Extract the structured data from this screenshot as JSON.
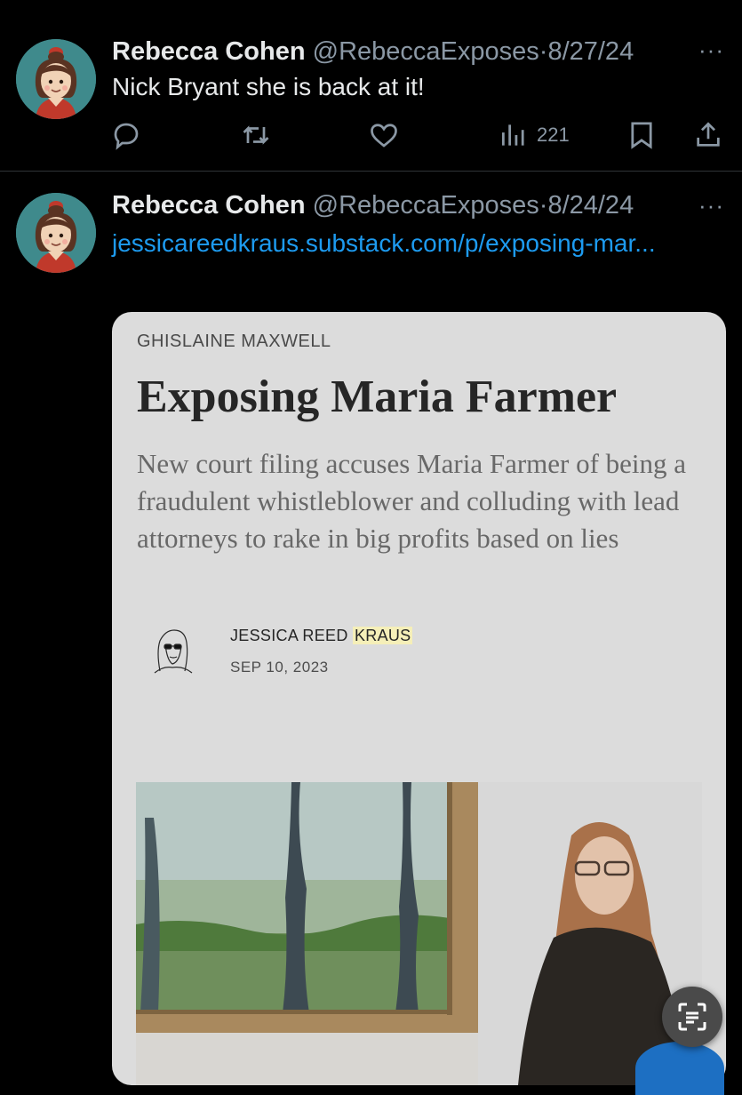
{
  "tweets": [
    {
      "author_name": "Rebecca Cohen",
      "handle": "@RebeccaExposes",
      "separator": "·",
      "date": "8/27/24",
      "text": "Nick Bryant she is back at it!",
      "views": "221",
      "more": "···"
    },
    {
      "author_name": "Rebecca Cohen",
      "handle": "@RebeccaExposes",
      "separator": "·",
      "date": "8/24/24",
      "link_text": "jessicareedkraus.substack.com/p/exposing-mar...",
      "more": "···"
    }
  ],
  "card": {
    "kicker": "GHISLAINE MAXWELL",
    "title": "Exposing Maria Farmer",
    "subtitle": "New court filing accuses Maria Farmer of being a fraudulent whistleblower and colluding with lead attorneys to rake in big profits based on lies",
    "author_first": "JESSICA REED",
    "author_last": "KRAUS",
    "date": "SEP 10, 2023"
  },
  "colors": {
    "background": "#000000",
    "link": "#1d9bf0",
    "muted": "#8b98a5",
    "card_bg": "#dcdcdc",
    "avatar_bg": "#3f8a8c",
    "highlight": "#f5efb8"
  },
  "icons": [
    "reply-icon",
    "retweet-icon",
    "like-icon",
    "views-icon",
    "bookmark-icon",
    "share-icon",
    "more-icon",
    "text-scan-icon"
  ]
}
